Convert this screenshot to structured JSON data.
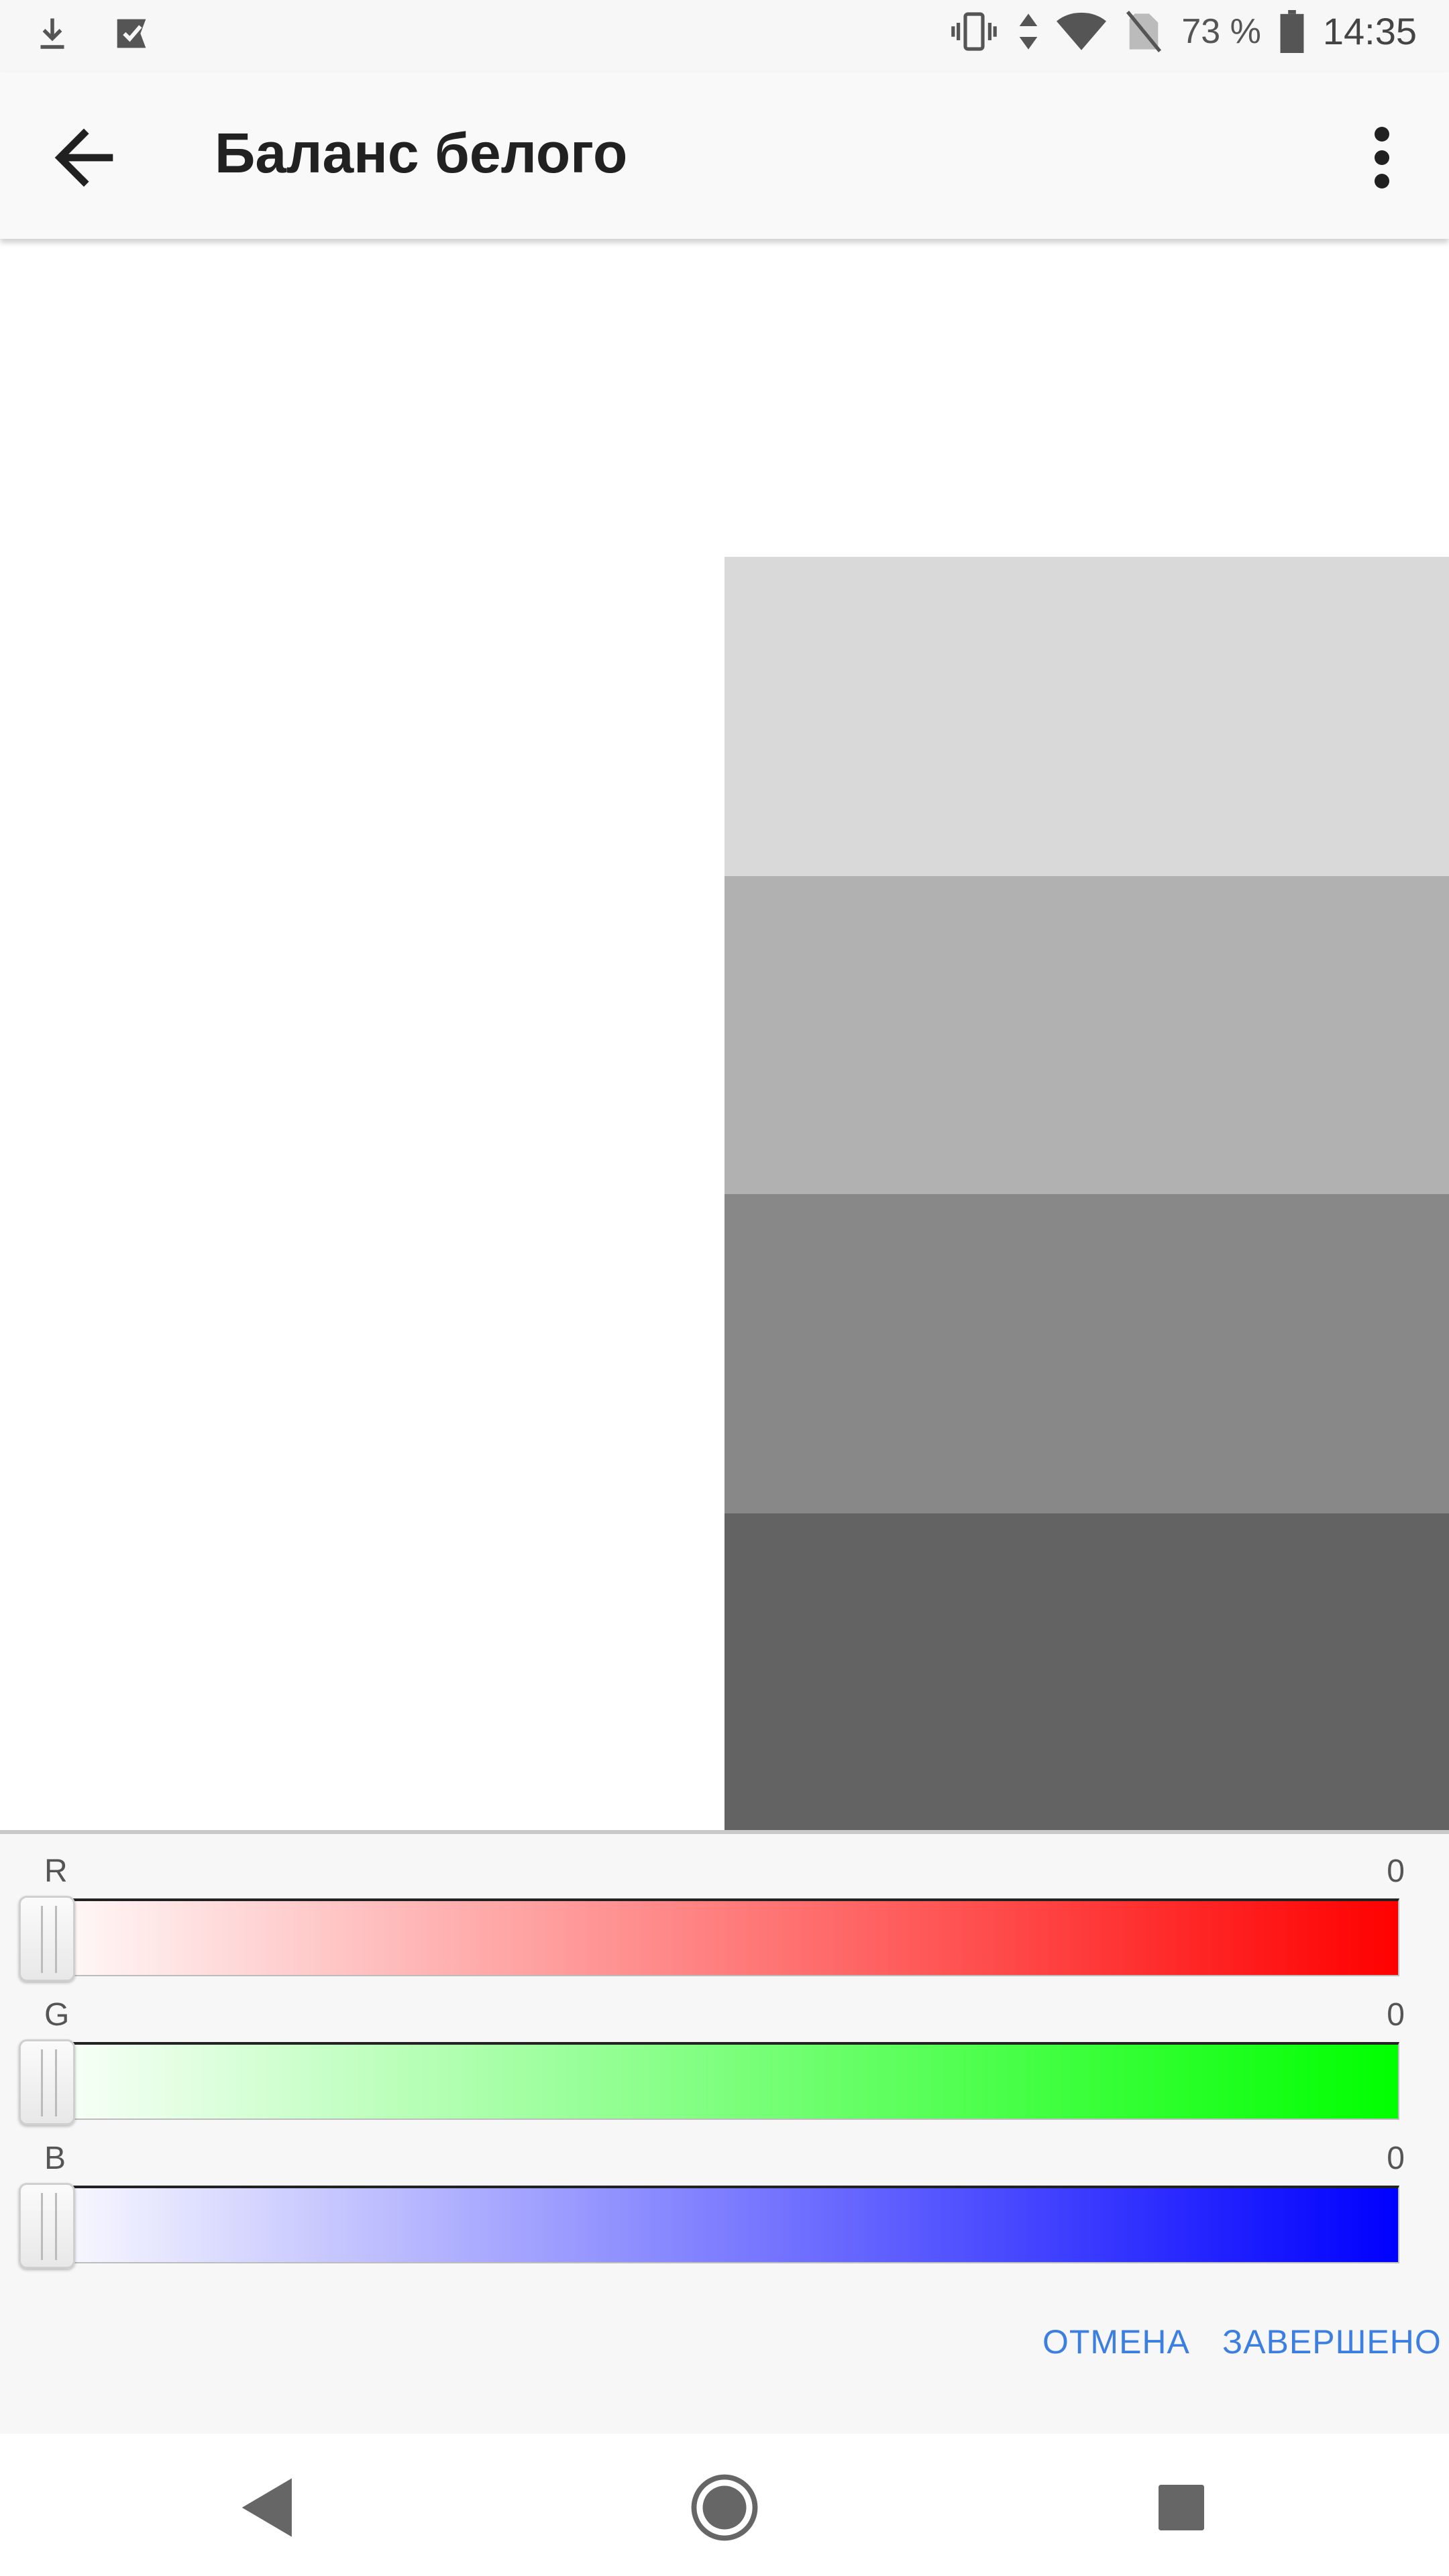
{
  "status_bar": {
    "battery": "73 %",
    "time": "14:35",
    "icons": [
      "download-icon",
      "inbox-icon",
      "vibrate-icon",
      "data-arrows-icon",
      "wifi-icon",
      "no-sim-icon",
      "battery-icon"
    ]
  },
  "app_bar": {
    "title": "Баланс белого"
  },
  "swatches": [
    "#d9d9d9",
    "#b1b1b1",
    "#888888",
    "#636363"
  ],
  "sliders": [
    {
      "label": "R",
      "value": "0",
      "color": "#ff0000"
    },
    {
      "label": "G",
      "value": "0",
      "color": "#00ff00"
    },
    {
      "label": "B",
      "value": "0",
      "color": "#0000ff"
    }
  ],
  "actions": {
    "cancel": "ОТМЕНА",
    "done": "ЗАВЕРШЕНО"
  }
}
